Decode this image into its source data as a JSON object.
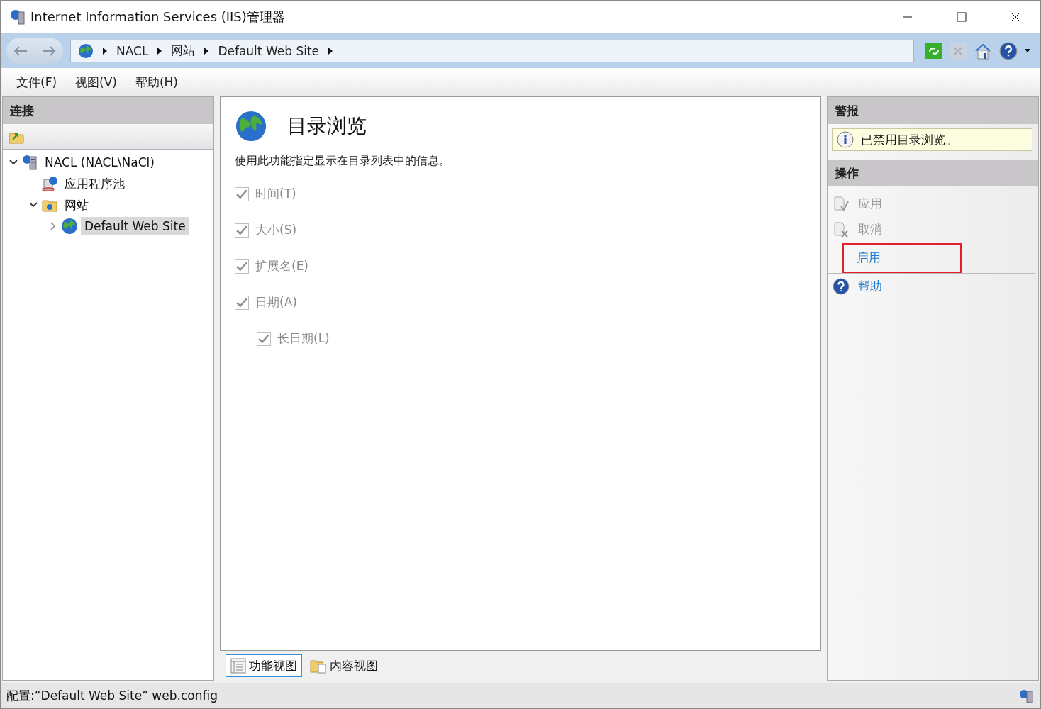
{
  "window": {
    "title": "Internet Information Services (IIS)管理器"
  },
  "breadcrumb": [
    "NACL",
    "网站",
    "Default Web Site"
  ],
  "menu": [
    "文件(F)",
    "视图(V)",
    "帮助(H)"
  ],
  "connections": {
    "title": "连接",
    "tree": [
      {
        "label": "NACL (NACL\\NaCl)",
        "kind": "server",
        "expanded": true,
        "selected": false,
        "children": [
          {
            "label": "应用程序池",
            "kind": "pool",
            "selected": false
          },
          {
            "label": "网站",
            "kind": "folder",
            "expanded": true,
            "selected": false,
            "children": [
              {
                "label": "Default Web Site",
                "kind": "site",
                "expanded": false,
                "selected": true
              }
            ]
          }
        ]
      }
    ]
  },
  "feature": {
    "title": "目录浏览",
    "description": "使用此功能指定显示在目录列表中的信息。",
    "options": [
      {
        "label": "时间(T)",
        "checked": true,
        "disabled": true
      },
      {
        "label": "大小(S)",
        "checked": true,
        "disabled": true
      },
      {
        "label": "扩展名(E)",
        "checked": true,
        "disabled": true
      },
      {
        "label": "日期(A)",
        "checked": true,
        "disabled": true,
        "children": [
          {
            "label": "长日期(L)",
            "checked": true,
            "disabled": true
          }
        ]
      }
    ]
  },
  "view_tabs": [
    {
      "label": "功能视图",
      "kind": "feature",
      "selected": true
    },
    {
      "label": "内容视图",
      "kind": "content",
      "selected": false
    }
  ],
  "alerts": {
    "title": "警报",
    "items": [
      "已禁用目录浏览。"
    ]
  },
  "actions": {
    "title": "操作",
    "items": [
      {
        "label": "应用",
        "kind": "apply",
        "disabled": true,
        "divider_before": false,
        "highlighted": false
      },
      {
        "label": "取消",
        "kind": "cancel",
        "disabled": true,
        "divider_before": false,
        "highlighted": false
      },
      {
        "label": "启用",
        "kind": "plain",
        "disabled": false,
        "divider_before": true,
        "highlighted": true
      },
      {
        "label": "帮助",
        "kind": "help",
        "disabled": false,
        "divider_before": true,
        "highlighted": false
      }
    ]
  },
  "status_bar": {
    "text": "配置:“Default Web Site” web.config"
  }
}
